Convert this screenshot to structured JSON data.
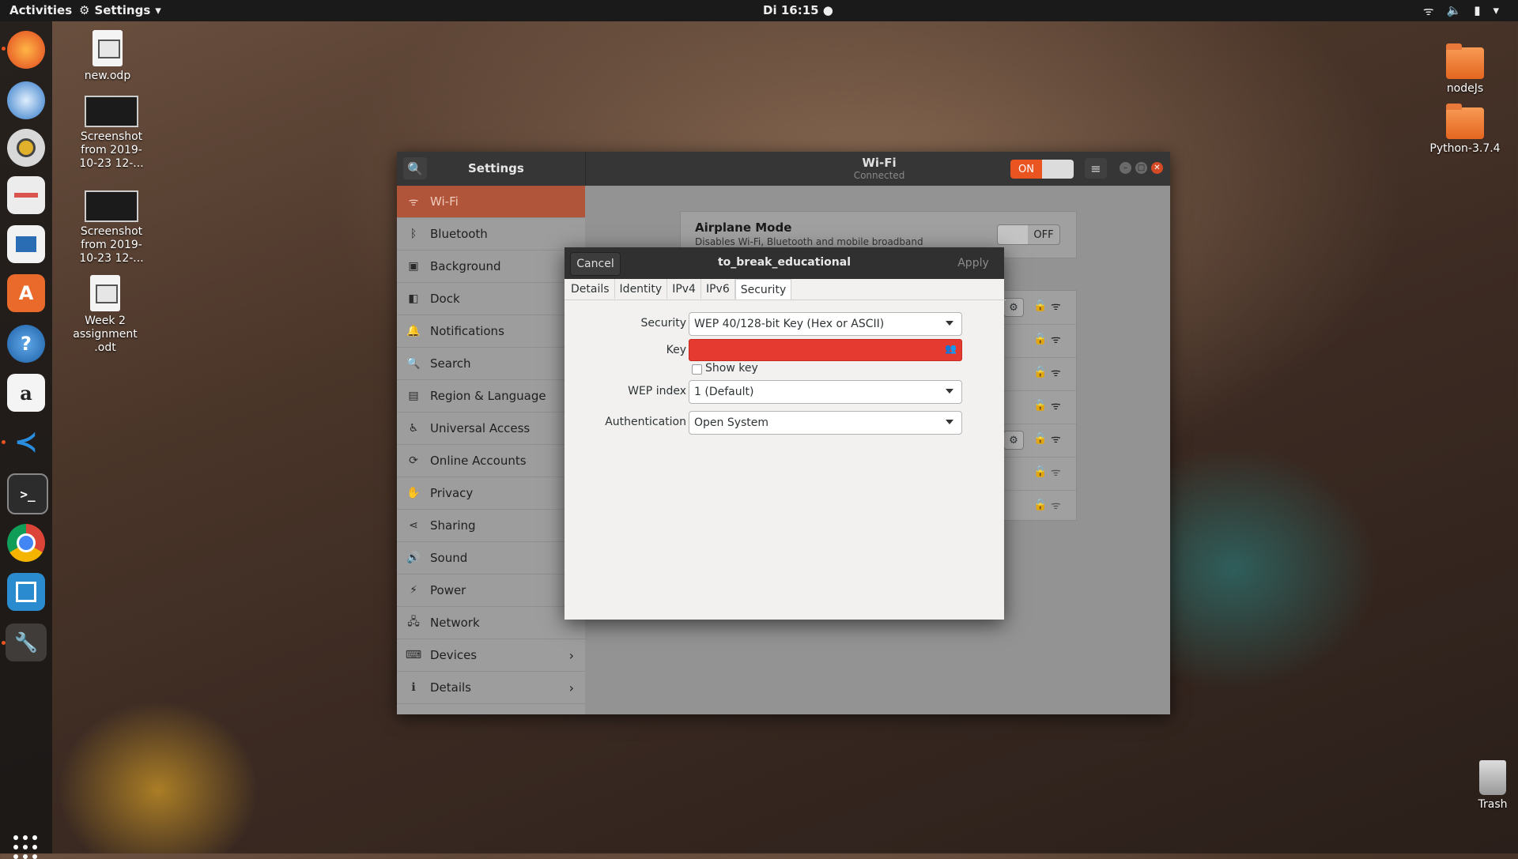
{
  "topbar": {
    "activities": "Activities",
    "app_menu": "Settings",
    "clock": "Di 16:15"
  },
  "desktop": {
    "icons": [
      {
        "label": "new.odp"
      },
      {
        "label": "Screenshot from 2019-10-23 12-..."
      },
      {
        "label": "Screenshot from 2019-10-23 12-..."
      },
      {
        "label": "Week 2 assignment .odt"
      },
      {
        "label": "nodeJs"
      },
      {
        "label": "Python-3.7.4"
      },
      {
        "label": "Trash"
      }
    ]
  },
  "dock": {
    "items": [
      "firefox-icon",
      "thunderbird-icon",
      "rhythmbox-icon",
      "files-icon",
      "writer-icon",
      "software-icon",
      "help-icon",
      "amazon-icon",
      "vscode-icon",
      "terminal-icon",
      "chrome-icon",
      "remote-icon",
      "settings-icon"
    ],
    "amazon_glyph": "a",
    "help_glyph": "?"
  },
  "settings": {
    "title": "Settings",
    "panel_title": "Wi-Fi",
    "panel_subtitle": "Connected",
    "wifi_toggle": "ON",
    "sidebar": [
      {
        "label": "Wi-Fi",
        "icon": "wifi-icon",
        "active": true
      },
      {
        "label": "Bluetooth",
        "icon": "bluetooth-icon"
      },
      {
        "label": "Background",
        "icon": "background-icon"
      },
      {
        "label": "Dock",
        "icon": "dock-icon"
      },
      {
        "label": "Notifications",
        "icon": "bell-icon"
      },
      {
        "label": "Search",
        "icon": "search-icon"
      },
      {
        "label": "Region & Language",
        "icon": "camera-icon"
      },
      {
        "label": "Universal Access",
        "icon": "accessibility-icon"
      },
      {
        "label": "Online Accounts",
        "icon": "accounts-icon"
      },
      {
        "label": "Privacy",
        "icon": "hand-icon"
      },
      {
        "label": "Sharing",
        "icon": "share-icon"
      },
      {
        "label": "Sound",
        "icon": "speaker-icon"
      },
      {
        "label": "Power",
        "icon": "power-icon"
      },
      {
        "label": "Network",
        "icon": "network-icon"
      },
      {
        "label": "Devices",
        "icon": "devices-icon",
        "chevron": true
      },
      {
        "label": "Details",
        "icon": "info-icon",
        "chevron": true
      }
    ],
    "airplane": {
      "title": "Airplane Mode",
      "desc": "Disables Wi-Fi, Bluetooth and mobile broadband",
      "toggle": "OFF"
    }
  },
  "dialog": {
    "cancel": "Cancel",
    "title": "to_break_educational",
    "apply": "Apply",
    "tabs": [
      "Details",
      "Identity",
      "IPv4",
      "IPv6",
      "Security"
    ],
    "active_tab": "Security",
    "security_label": "Security",
    "security_value": "WEP 40/128-bit Key (Hex or ASCII)",
    "key_label": "Key",
    "show_key": "Show key",
    "wep_index_label": "WEP index",
    "wep_index_value": "1 (Default)",
    "auth_label": "Authentication",
    "auth_value": "Open System"
  },
  "colors": {
    "accent": "#e95420",
    "key_error": "#e53a2f"
  }
}
